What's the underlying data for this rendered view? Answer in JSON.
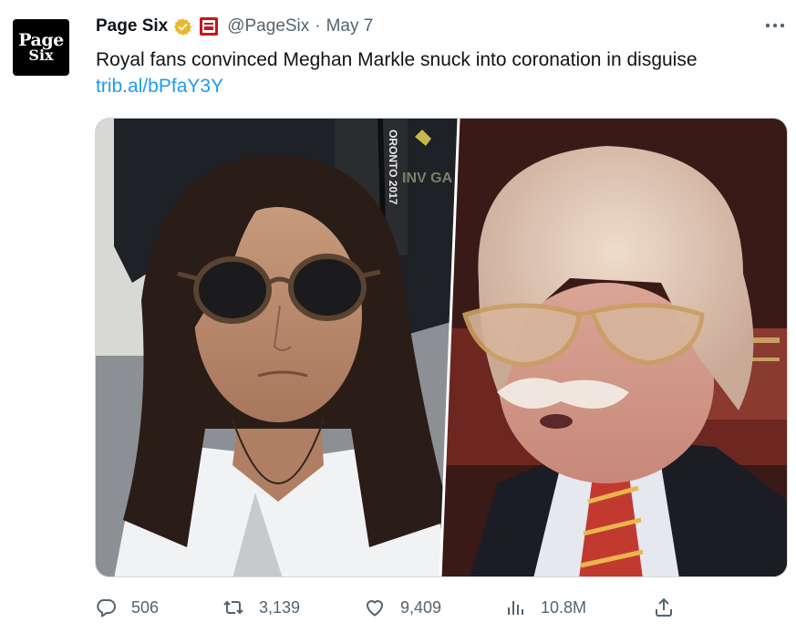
{
  "author": {
    "avatar_line1": "Page",
    "avatar_line2": "Six",
    "display_name": "Page Six",
    "handle": "@PageSix",
    "separator": "·",
    "date": "May 7",
    "verified_icon": "verified-badge-gold",
    "affiliate_icon": "new-york-post-badge"
  },
  "tweet": {
    "text": "Royal fans convinced Meghan Markle snuck into coronation in disguise",
    "link": "trib.al/bPfaY3Y"
  },
  "media": {
    "left_photo_lanyard_text": "ORONTO 2017",
    "left_photo_shirt_text": "INV GA"
  },
  "actions": {
    "replies": "506",
    "retweets": "3,139",
    "likes": "9,409",
    "views": "10.8M"
  },
  "colors": {
    "accent": "#1d9bf0",
    "secondary_text": "#536471",
    "verified_gold": "#e8b829",
    "nypost_red": "#c4161c"
  }
}
